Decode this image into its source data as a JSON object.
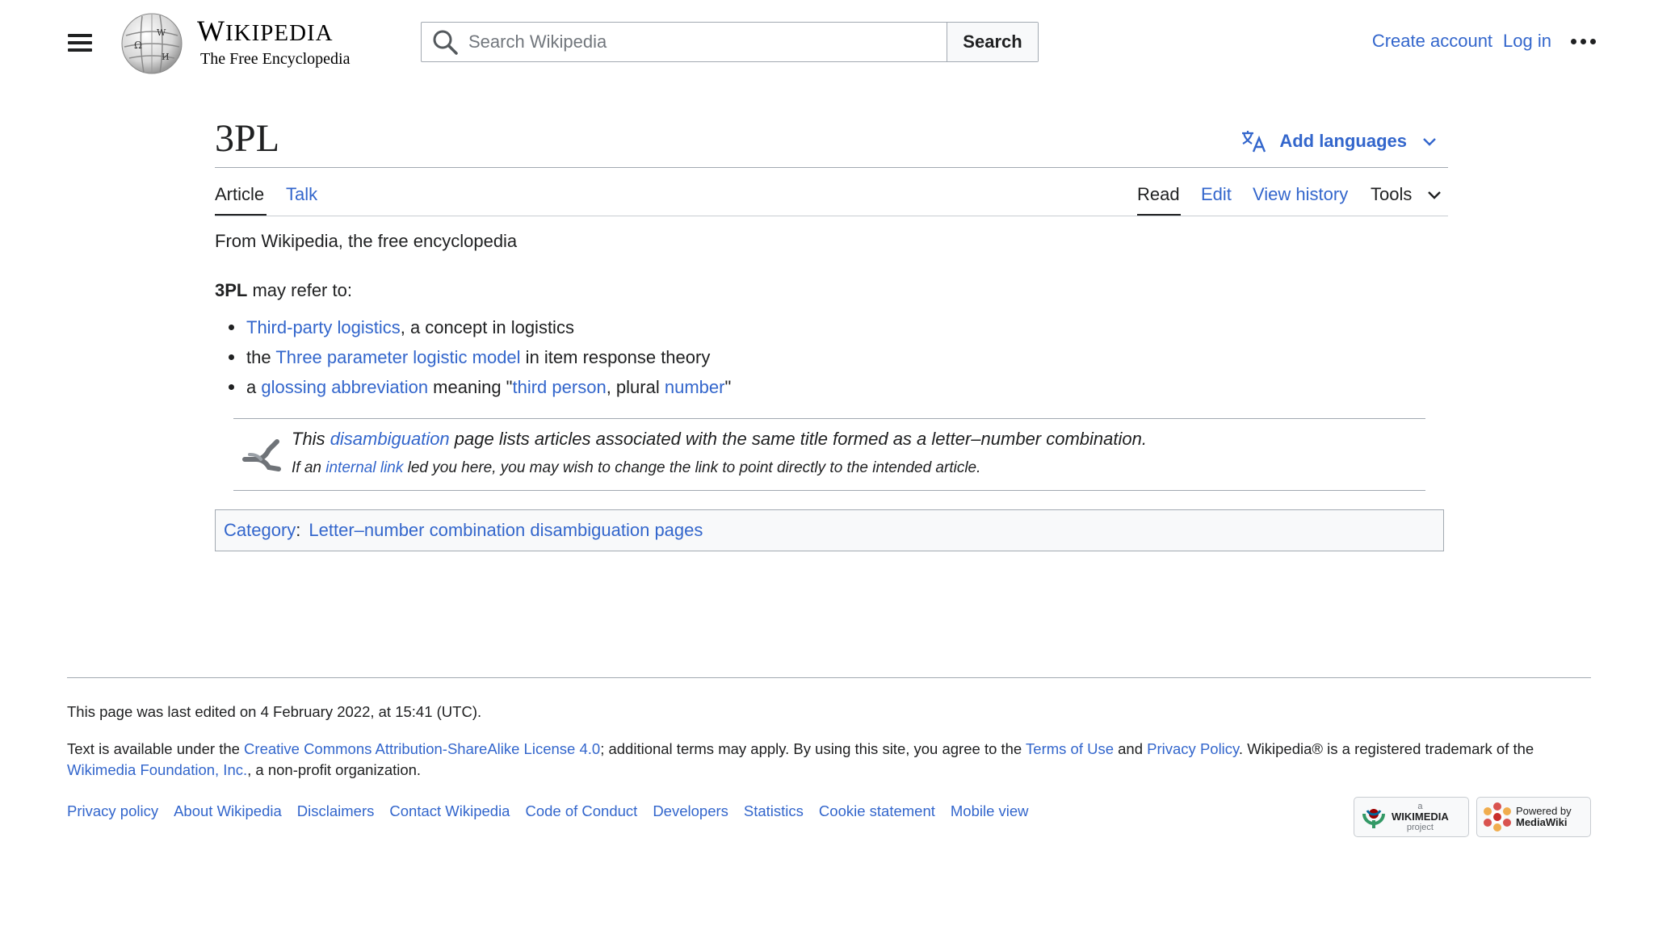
{
  "header": {
    "wordmark_main_first": "W",
    "wordmark_main_rest": "IKIPEDIA",
    "wordmark_tagline": "The Free Encyclopedia",
    "search_placeholder": "Search Wikipedia",
    "search_button": "Search",
    "create_account": "Create account",
    "log_in": "Log in"
  },
  "page": {
    "title": "3PL",
    "add_languages": "Add languages",
    "tabs_left": [
      "Article",
      "Talk"
    ],
    "tabs_right": [
      "Read",
      "Edit",
      "View history",
      "Tools"
    ],
    "tagline": "From Wikipedia, the free encyclopedia",
    "intro_bold": "3PL",
    "intro_rest": " may refer to:",
    "items": [
      {
        "pre": "",
        "link": "Third-party logistics",
        "post": ", a concept in logistics"
      },
      {
        "pre": "the ",
        "link": "Three parameter logistic model",
        "post": " in item response theory"
      },
      {
        "pre": "a ",
        "link": "glossing abbreviation",
        "mid": " meaning \"",
        "link2": "third person",
        "mid2": ", plural ",
        "link3": "number",
        "post": "\""
      }
    ],
    "disambig": {
      "l1_pre": "This ",
      "l1_link": "disambiguation",
      "l1_post": " page lists articles associated with the same title formed as a letter–number combination.",
      "l2_pre": "If an ",
      "l2_link": "internal link",
      "l2_post": " led you here, you may wish to change the link to point directly to the intended article."
    },
    "category_label": "Category",
    "category_sep": ":",
    "category": "Letter–number combination disambiguation pages"
  },
  "footer": {
    "last_edited": "This page was last edited on 4 February 2022, at 15:41 (UTC).",
    "lic_1": "Text is available under the ",
    "lic_link1": "Creative Commons Attribution-ShareAlike License 4.0",
    "lic_2": "; additional terms may apply. By using this site, you agree to the ",
    "lic_link2": "Terms of Use",
    "lic_3": " and ",
    "lic_link3": "Privacy Policy",
    "lic_4": ". Wikipedia® is a registered trademark of the ",
    "lic_link4": "Wikimedia Foundation, Inc.",
    "lic_5": ", a non-profit organization.",
    "links": [
      "Privacy policy",
      "About Wikipedia",
      "Disclaimers",
      "Contact Wikipedia",
      "Code of Conduct",
      "Developers",
      "Statistics",
      "Cookie statement",
      "Mobile view"
    ],
    "wikimedia_badge": {
      "small": "a",
      "main": "WIKIMEDIA",
      "sub": "project"
    },
    "mediawiki_badge": {
      "line1": "Powered by",
      "line2": "MediaWiki"
    }
  },
  "colors": {
    "link": "#3366cc",
    "text": "#202122",
    "border": "#a2a9b1"
  }
}
